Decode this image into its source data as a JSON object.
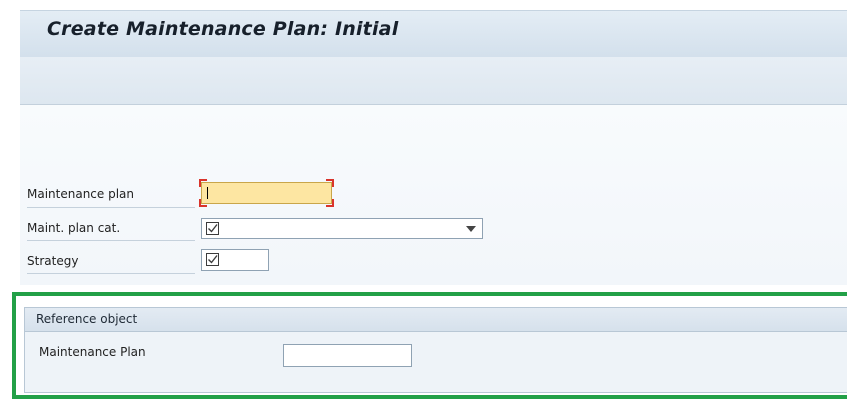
{
  "header": {
    "title": "Create Maintenance Plan: Initial"
  },
  "form": {
    "maintenance_plan": {
      "label": "Maintenance plan",
      "value": ""
    },
    "maint_plan_cat": {
      "label": "Maint. plan cat.",
      "icon": "checkbox-input-icon"
    },
    "strategy": {
      "label": "Strategy",
      "icon": "checkbox-input-icon"
    }
  },
  "reference_object": {
    "title": "Reference object",
    "maintenance_plan": {
      "label": "Maintenance Plan",
      "value": ""
    }
  },
  "colors": {
    "highlight_border": "#22a047",
    "focus_fill": "#fde6a2",
    "focus_corner": "#d9342b"
  }
}
